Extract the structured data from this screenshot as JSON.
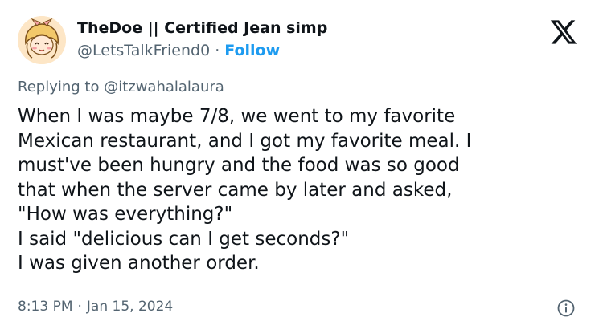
{
  "tweet": {
    "author": {
      "display_name": "TheDoe || Certified Jean simp",
      "handle": "@LetsTalkFriend0",
      "separator": "·",
      "follow_label": "Follow"
    },
    "replying_prefix": "Replying to ",
    "replying_to": "@itzwahalalaura",
    "text": "When I was maybe 7/8, we went to my favorite\nMexican restaurant, and I got my favorite meal. I\nmust've been hungry and the food was so good\nthat when the server came by later and asked,\n\"How was everything?\"\n I said \"delicious can I get seconds?\"\nI was given another order.",
    "time": "8:13 PM",
    "date_separator": "·",
    "date": "Jan 15, 2024"
  },
  "icons": {
    "platform_logo": "x-logo-icon",
    "info": "info-icon",
    "avatar": "anime-avatar"
  },
  "colors": {
    "text_primary": "#0f1419",
    "text_secondary": "#536471",
    "accent": "#1d9bf0"
  }
}
